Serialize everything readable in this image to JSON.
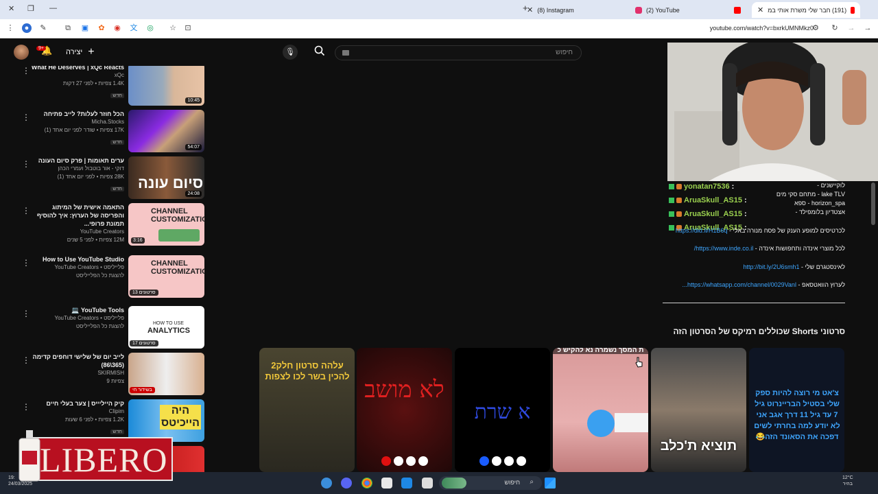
{
  "browser": {
    "tabs": [
      {
        "label": "(191) חבר שלי משרת אותי במ",
        "active": true
      },
      {
        "label": "(2) YouTube",
        "active": false
      },
      {
        "label": "(8) Instagram",
        "active": false
      }
    ],
    "url": "youtube.com/watch?v=bxrkUMNMkz0"
  },
  "youtube": {
    "search_placeholder": "חיפוש",
    "create_label": "יצירה",
    "notification_count": "9+"
  },
  "sidebar_videos": [
    {
      "title": "What He Deserves | xQc Reacts",
      "channel": "xQc",
      "stats": "1.4K צפיות • לפני 27 דקות",
      "badge": "חדש",
      "duration": "10:45"
    },
    {
      "title": "הכל חוזר לעלות? לייב פתיחה",
      "channel": "Micha.Stocks",
      "stats": "17K צפיות • שודר לפני יום אחד (1)",
      "badge": "חדש",
      "duration": "54:07"
    },
    {
      "title": "ערים תאומות | פרק סיום העונה",
      "channel": "דוקי - אור בוטבול ועמרי הכהן",
      "stats": "28K צפיות • לפני יום אחד (1)",
      "badge": "חדש",
      "duration": "24:08"
    },
    {
      "title": "התאמה אישית של המיתוג והפריסה של הערוץ: איך להוסיף תמונת פרופי...",
      "channel": "YouTube Creators",
      "stats": "12M צפיות • לפני 5 שנים",
      "badge": "",
      "duration": "3:16"
    },
    {
      "title": "How to Use YouTube Studio",
      "channel": "פלייליסט • YouTube Creators",
      "stats": "להצגת כל הפלייליסט",
      "badge": "",
      "duration": "13 סרטונים"
    },
    {
      "title": "YouTube Tools 💻",
      "channel": "פלייליסט • YouTube Creators",
      "stats": "להצגת כל הפלייליסט",
      "badge": "",
      "duration": "17 סרטונים"
    },
    {
      "title": "לייב יום של שלישי דוחפים קדימה (365\\86)",
      "channel": "SKIRMISH",
      "stats": "צפיות 9",
      "badge": "",
      "duration": "בשידור חי"
    },
    {
      "title": "קיק הייליייס | צער בעלי חיים",
      "channel": "Clipim",
      "stats": "1.2K צפיות • לפני 6 שעות",
      "badge": "חדש",
      "duration": ""
    }
  ],
  "thumb_texts": {
    "channel_custom": "CHANNEL CUSTOMIZATION",
    "how_to_use": "HOW TO USE",
    "analytics": "ANALYTICS",
    "siyum": "סיום עונה",
    "hiya": "היה הייכיטס"
  },
  "chat": [
    {
      "user": "yonatan7536",
      "sep": ":"
    },
    {
      "user": "AruaSkull_AS15",
      "sep": ":"
    },
    {
      "user": "AruaSkull_AS15",
      "sep": ":"
    },
    {
      "user": "AruaSkull_AS15",
      "sep": ":"
    }
  ],
  "description": {
    "lines_top": [
      "לוקיישנים -",
      "lake TLV - מתחם סקי מים",
      "horizon_spa - ספא",
      "אצטדיון בלומפילד -"
    ],
    "links": [
      {
        "text": "לכרטיסים למופע הענק של פסח מנורה באלי -",
        "url": "https://did.li/H1B6q"
      },
      {
        "text": "לכל מוצרי אינדה ותחפושות אינדה -",
        "url": "https://www.inde.co.il/"
      },
      {
        "text": "לאינסטגרם שלי -",
        "url": "http://bit.ly/2U6smh1"
      },
      {
        "text": "לערוץ הוואטסאפ -",
        "url": "https://whatsapp.com/channel/0029Vanl..."
      }
    ]
  },
  "shorts_title": "סרטוני Shorts שכוללים רמיקס של הסרטון הזה",
  "shorts": [
    {
      "text": "צ'אט מי רוצה להיות ספק שלי בסטיל הבריינרוט גיל 7 עד גיל 11 דרך אגב אני לא יודע למה בחרתי לשים דפכה את הסאונד הזה😂"
    },
    {
      "text": "תוציא ת'כלב"
    },
    {
      "text": "ת המסך נשמרה נא להקיש כ"
    },
    {
      "text": "א שרת"
    },
    {
      "text": "לא מושב"
    },
    {
      "text": "עלהה סרטון חלק2 להכין בשר לכו לצפות"
    }
  ],
  "overlay": {
    "brand": "LIBERO"
  },
  "taskbar": {
    "search_label": "חיפוש",
    "time": "19:",
    "date": "24/03/2025",
    "temp": "12°C",
    "weather": "בהיר"
  }
}
